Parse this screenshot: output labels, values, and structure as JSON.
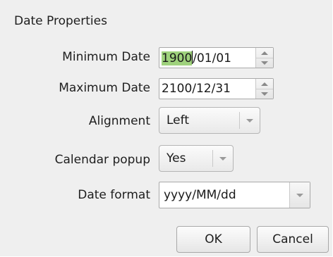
{
  "dialog": {
    "title": "Date Properties"
  },
  "minimum_date": {
    "label": "Minimum Date",
    "value_selected": "1900",
    "value_rest": "/01/01"
  },
  "maximum_date": {
    "label": "Maximum Date",
    "value": "2100/12/31"
  },
  "alignment": {
    "label": "Alignment",
    "value": "Left"
  },
  "calendar_popup": {
    "label": "Calendar popup",
    "value": "Yes"
  },
  "date_format": {
    "label": "Date format",
    "value": "yyyy/MM/dd"
  },
  "buttons": {
    "ok": "OK",
    "cancel": "Cancel"
  },
  "colors": {
    "selection": "#9fd27d",
    "dialog_bg": "#efefef"
  }
}
